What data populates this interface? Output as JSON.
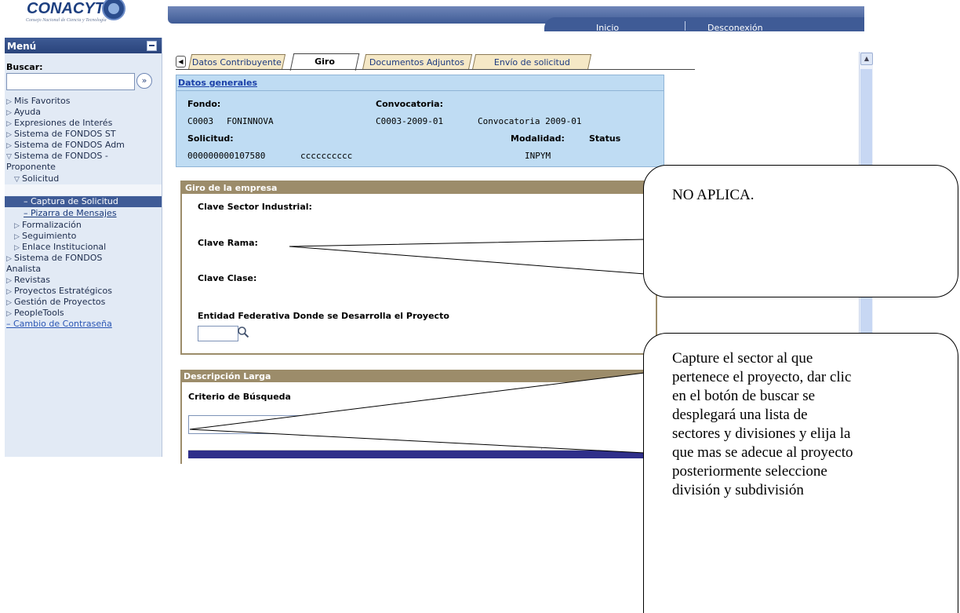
{
  "logo": {
    "name": "CONACYT",
    "subtitle": "Consejo Nacional de Ciencia y Tecnología"
  },
  "header": {
    "nav_inicio": "Inicio",
    "nav_desconexion": "Desconexión"
  },
  "sidebar": {
    "title": "Menú",
    "search_label": "Buscar:",
    "search_value": "",
    "items": [
      {
        "label": "Mis Favoritos"
      },
      {
        "label": "Ayuda"
      },
      {
        "label": "Expresiones de Interés"
      },
      {
        "label": "Sistema de FONDOS ST"
      },
      {
        "label": "Sistema de FONDOS Adm"
      },
      {
        "label": "Sistema de FONDOS -"
      },
      {
        "label": "Proponente"
      },
      {
        "label": "Solicitud"
      },
      {
        "label": "Captura de Solicitud"
      },
      {
        "label": "Pizarra de Mensajes"
      },
      {
        "label": "Formalización"
      },
      {
        "label": "Seguimiento"
      },
      {
        "label": "Enlace Institucional"
      },
      {
        "label": "Sistema de FONDOS"
      },
      {
        "label": "Analista"
      },
      {
        "label": "Revistas"
      },
      {
        "label": "Proyectos Estratégicos"
      },
      {
        "label": "Gestión de Proyectos"
      },
      {
        "label": "PeopleTools"
      },
      {
        "label": "Cambio de Contraseña"
      }
    ]
  },
  "tabs": [
    {
      "label": "Datos Contribuyente",
      "active": false
    },
    {
      "label": "Giro",
      "active": true
    },
    {
      "label": "Documentos Adjuntos",
      "active": false
    },
    {
      "label": "Envío de solicitud",
      "active": false
    }
  ],
  "datos_generales": {
    "title": "Datos generales",
    "fondo_label": "Fondo:",
    "fondo_code": "C0003",
    "fondo_name": "FONINNOVA",
    "convocatoria_label": "Convocatoria:",
    "convocatoria_code": "C0003-2009-01",
    "convocatoria_name": "Convocatoria 2009-01",
    "solicitud_label": "Solicitud:",
    "solicitud_number": "000000000107580",
    "solicitud_text": "cccccccccc",
    "modalidad_label": "Modalidad:",
    "modalidad_value": "INPYM",
    "status_label": "Status"
  },
  "giro": {
    "title": "Giro de la empresa",
    "sector_label": "Clave Sector Industrial:",
    "rama_label": "Clave Rama:",
    "clase_label": "Clave Clase:",
    "entidad_label": "Entidad Federativa Donde se Desarrolla el Proyecto",
    "entidad_value": ""
  },
  "descripcion": {
    "title": "Descripción Larga",
    "criterio_label": "Criterio de Búsqueda",
    "criterio_value": ""
  },
  "callouts": {
    "c1": "NO APLICA.",
    "c2": "Capture el sector  al que\npertenece el proyecto, dar clic\nen el botón de buscar se\ndesplegará una lista de\nsectores y divisiones y elija la\nque mas se adecue al proyecto\nposteriormente seleccione\ndivisión y subdivisión"
  },
  "colors": {
    "banner": "#3f5b96",
    "panel_blue": "#bfdcf3",
    "panel_tan": "#9c8c6a",
    "tab_bg": "#f5e8c6"
  }
}
